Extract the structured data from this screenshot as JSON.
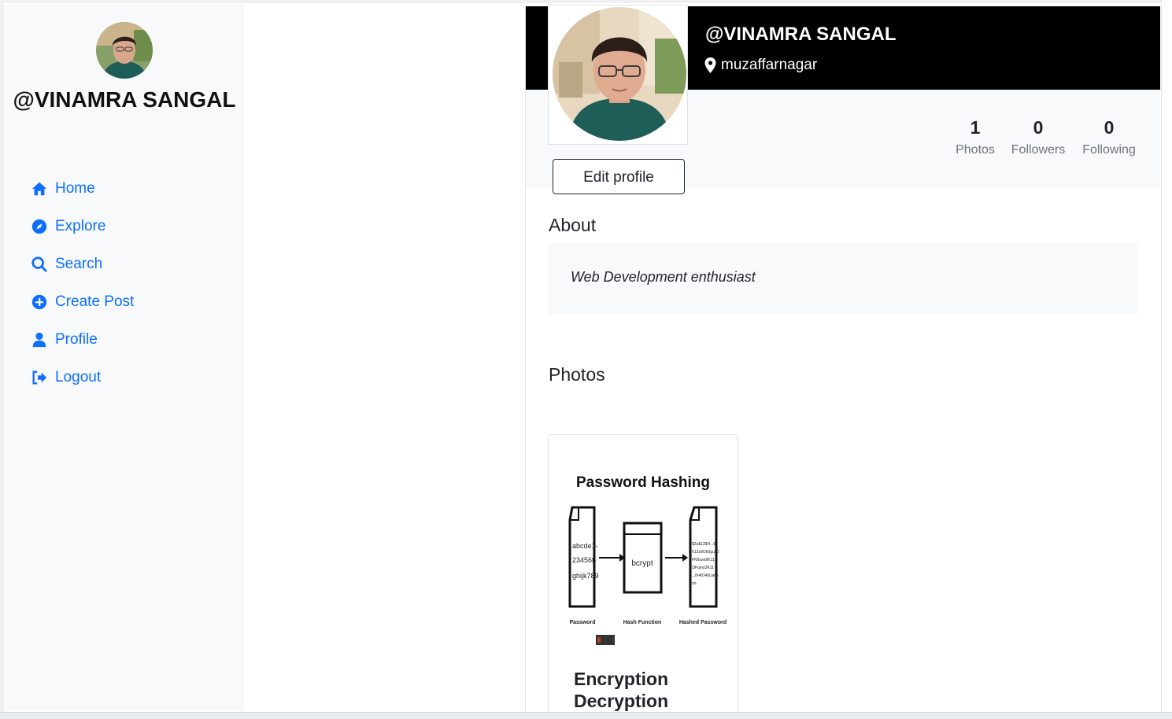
{
  "user": {
    "handle": "@VINAMRA SANGAL",
    "location": "muzaffarnagar"
  },
  "sidebar": {
    "name": "@VINAMRA SANGAL",
    "items": [
      {
        "label": "Home",
        "icon": "home-icon"
      },
      {
        "label": "Explore",
        "icon": "compass-icon"
      },
      {
        "label": "Search",
        "icon": "search-icon"
      },
      {
        "label": "Create Post",
        "icon": "plus-circle-icon"
      },
      {
        "label": "Profile",
        "icon": "user-icon"
      },
      {
        "label": "Logout",
        "icon": "logout-icon"
      }
    ]
  },
  "profile": {
    "edit_label": "Edit profile",
    "stats": [
      {
        "value": "1",
        "label": "Photos"
      },
      {
        "value": "0",
        "label": "Followers"
      },
      {
        "value": "0",
        "label": "Following"
      }
    ],
    "about_title": "About",
    "about_text": "Web Development enthusiast",
    "photos_title": "Photos"
  },
  "posts": [
    {
      "title": "Encryption Decryption",
      "image": {
        "heading": "Password Hashing",
        "input_text": [
          "abcde1-",
          "23456f-",
          "ghijk789"
        ],
        "function_text": "bcrypt",
        "output_text": [
          "$2a$12$H...9e",
          "h12a9Ob5gu20",
          "FN9uxo9K11...",
          "i3Fqmo3K11",
          "...Ih4IO4bUa6s",
          "on"
        ],
        "captions": [
          "Password",
          "Hash Function",
          "Hashed Password"
        ]
      }
    }
  ],
  "colors": {
    "accent": "#0d6efd",
    "banner": "#000000",
    "sidebar_bg": "#f8f9fa"
  }
}
